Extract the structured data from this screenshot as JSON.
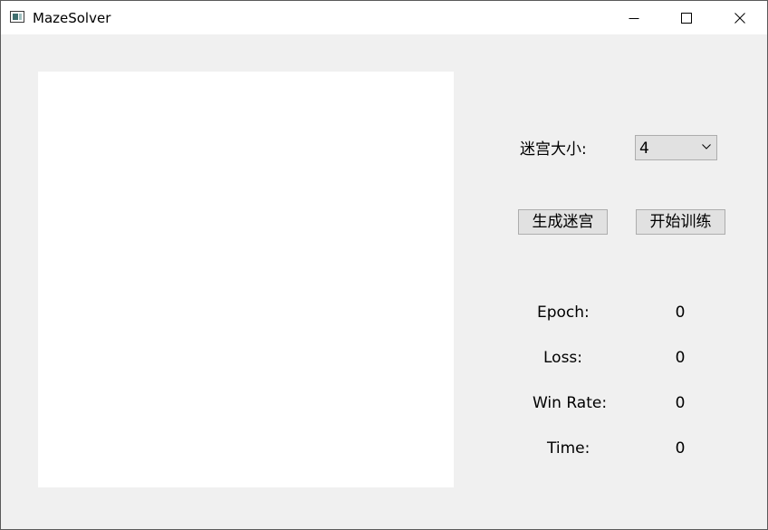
{
  "window": {
    "title": "MazeSolver",
    "icon": "app-window-icon",
    "controls": [
      "minimize-icon",
      "maximize-icon",
      "close-icon"
    ]
  },
  "maze_size": {
    "label": "迷宫大小:",
    "selected": "4"
  },
  "buttons": {
    "generate": "生成迷宫",
    "train": "开始训练"
  },
  "stats": {
    "epoch_label": "Epoch:",
    "epoch_value": "0",
    "loss_label": "Loss:",
    "loss_value": "0",
    "winrate_label": "Win Rate:",
    "winrate_value": "0",
    "time_label": "Time:",
    "time_value": "0"
  }
}
